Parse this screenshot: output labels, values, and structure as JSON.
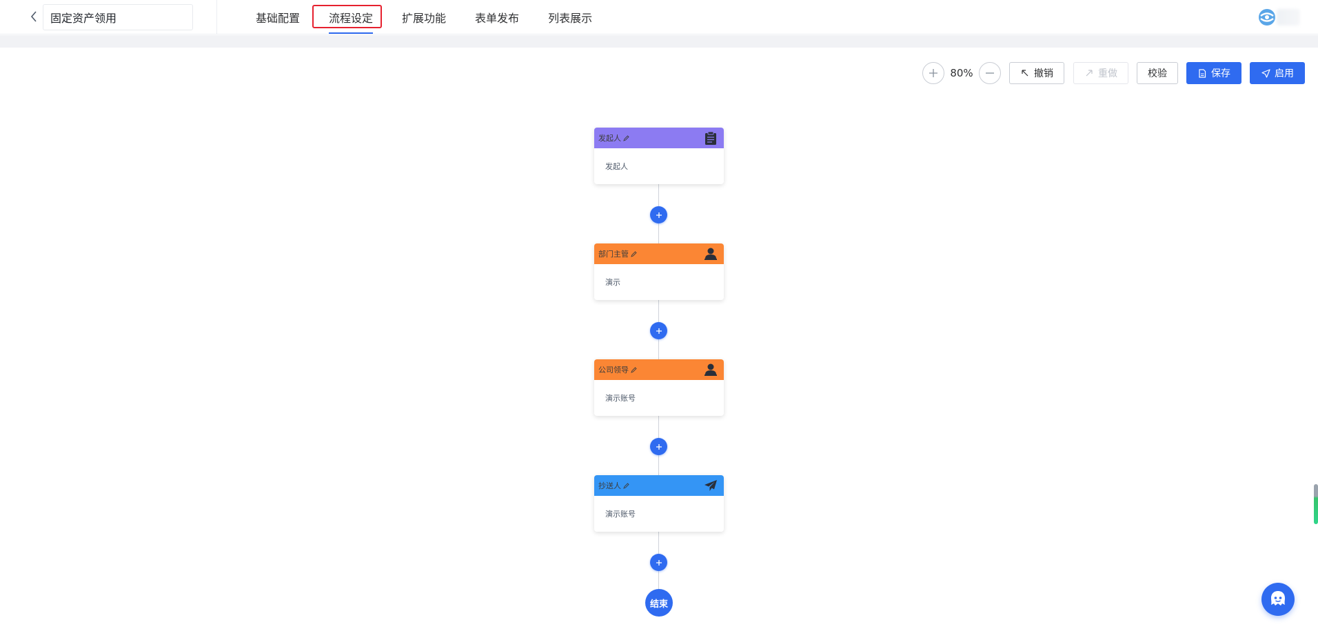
{
  "header": {
    "title": "固定资产领用",
    "tabs": [
      {
        "label": "基础配置"
      },
      {
        "label": "流程设定"
      },
      {
        "label": "扩展功能"
      },
      {
        "label": "表单发布"
      },
      {
        "label": "列表展示"
      }
    ],
    "active_tab": "流程设定"
  },
  "toolbar": {
    "zoom": "80%",
    "undo_label": "撤销",
    "redo_label": "重做",
    "validate_label": "校验",
    "save_label": "保存",
    "enable_label": "启用"
  },
  "flow": {
    "nodes": [
      {
        "title": "发起人",
        "content": "发起人",
        "color": "#8c7bf2",
        "icon": "clipboard-icon"
      },
      {
        "title": "部门主管",
        "content": "演示",
        "color": "#fb8634",
        "icon": "user-icon"
      },
      {
        "title": "公司领导",
        "content": "演示账号",
        "color": "#fb8634",
        "icon": "user-icon"
      },
      {
        "title": "抄送人",
        "content": "演示账号",
        "color": "#3495f5",
        "icon": "paper-plane-icon"
      }
    ],
    "end_label": "结束"
  },
  "colors": {
    "primary": "#2f6bf0",
    "highlight": "#e6202e"
  }
}
